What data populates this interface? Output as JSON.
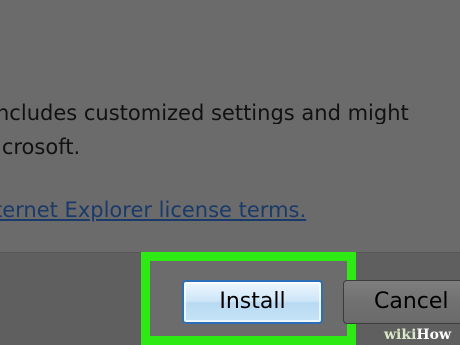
{
  "dialog": {
    "line1": "ncludes customized settings and might",
    "line2": "icrosoft.",
    "license_link": "ternet Explorer license terms."
  },
  "buttons": {
    "install_label": "Install",
    "cancel_label": "Cancel"
  },
  "watermark": {
    "part1": "wiki",
    "part2": "How"
  },
  "colors": {
    "highlight": "#2dea15",
    "install_border": "#2d6fb6",
    "link": "#1a3a6a"
  }
}
